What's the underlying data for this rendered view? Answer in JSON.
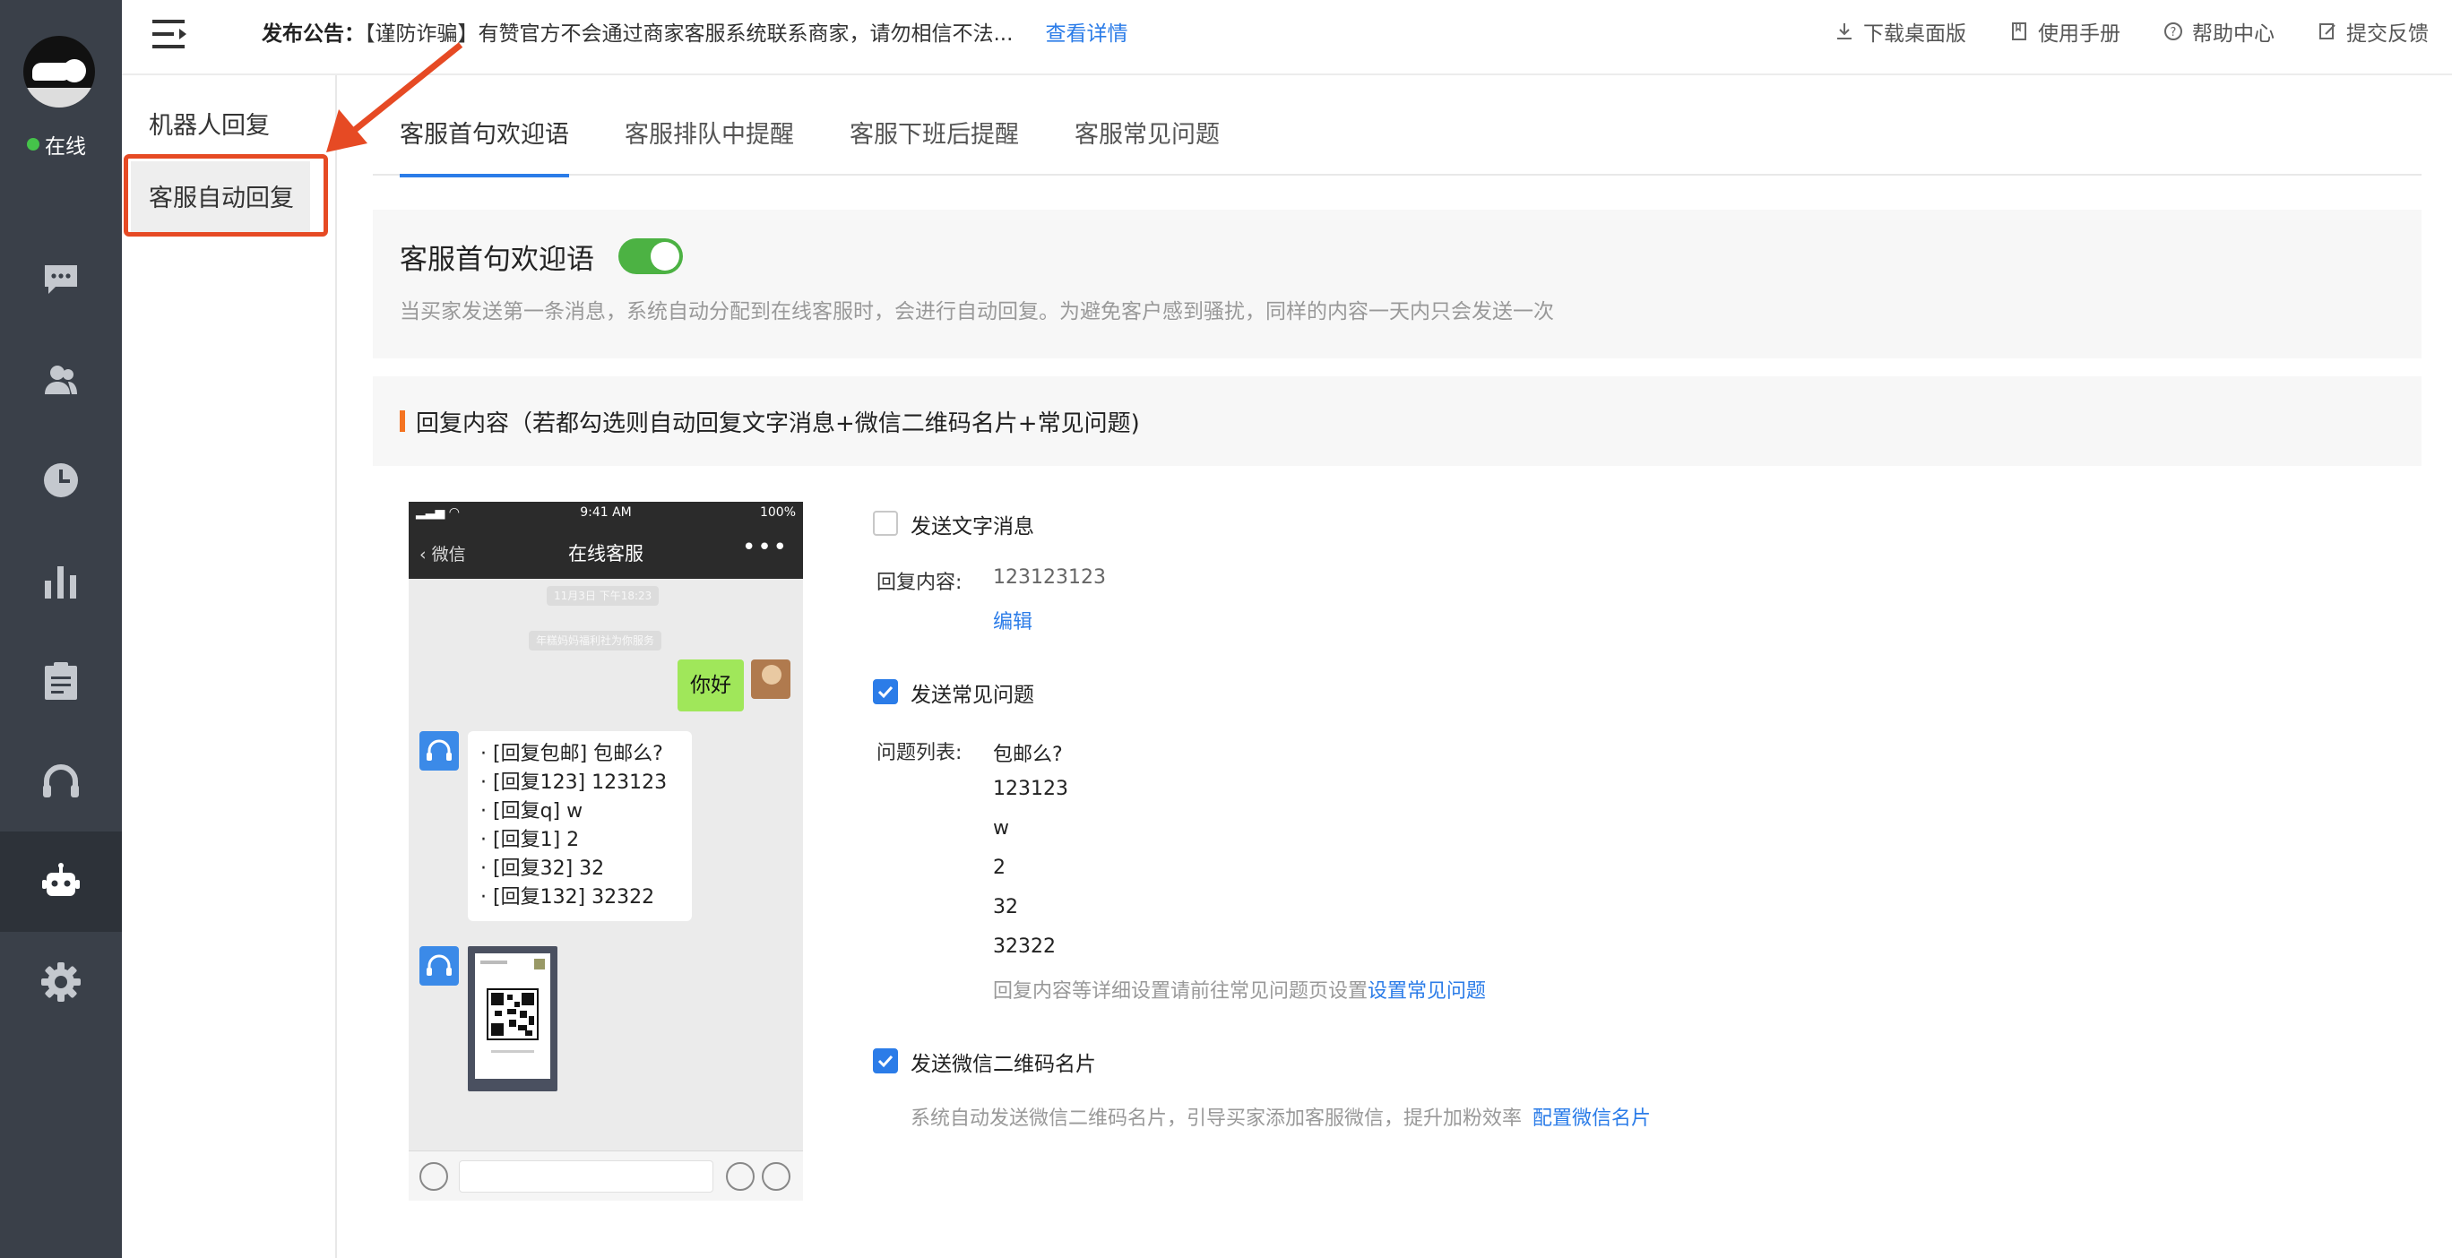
{
  "rail": {
    "status": "在线",
    "nav_icons": [
      "chat-icon",
      "contacts-icon",
      "history-icon",
      "stats-icon",
      "notes-icon",
      "headset-icon",
      "robot-icon",
      "gear-icon"
    ]
  },
  "subnav": {
    "items": [
      {
        "label": "机器人回复"
      },
      {
        "label": "客服自动回复"
      }
    ]
  },
  "topbar": {
    "notice_label": "发布公告：",
    "notice_text": "【谨防诈骗】有赞官方不会通过商家客服系统联系商家，请勿相信不法...",
    "notice_more": "查看详情",
    "links": [
      {
        "label": "下载桌面版",
        "icon": "download-icon"
      },
      {
        "label": "使用手册",
        "icon": "book-icon"
      },
      {
        "label": "帮助中心",
        "icon": "help-icon"
      },
      {
        "label": "提交反馈",
        "icon": "edit-icon"
      }
    ]
  },
  "tabs": [
    {
      "label": "客服首句欢迎语"
    },
    {
      "label": "客服排队中提醒"
    },
    {
      "label": "客服下班后提醒"
    },
    {
      "label": "客服常见问题"
    }
  ],
  "welcome": {
    "title": "客服首句欢迎语",
    "toggle_on": true,
    "description": "当买家发送第一条消息，系统自动分配到在线客服时，会进行自动回复。为避免客户感到骚扰，同样的内容一天内只会发送一次"
  },
  "section": {
    "title": "回复内容（若都勾选则自动回复文字消息+微信二维码名片+常见问题)"
  },
  "phone": {
    "time": "9:41 AM",
    "battery": "100%",
    "back": "微信",
    "title": "在线客服",
    "more": "•••",
    "pill_time": "11月3日 下午18:23",
    "pill_service": "年糕妈妈福利社为你服务",
    "my_message": "你好",
    "faq_lines": [
      "· [回复包邮] 包邮么?",
      "· [回复123] 123123",
      "· [回复q] w",
      "· [回复1] 2",
      "· [回复32] 32",
      "· [回复132] 32322"
    ]
  },
  "settings": {
    "text_msg": {
      "label": "发送文字消息",
      "checked": false,
      "content_label": "回复内容:",
      "content_value": "123123123",
      "edit": "编辑"
    },
    "faq": {
      "label": "发送常见问题",
      "checked": true,
      "list_label": "问题列表:",
      "items": [
        "包邮么?",
        "123123",
        "w",
        "2",
        "32",
        "32322"
      ],
      "hint": "回复内容等详细设置请前往常见问题页设置",
      "hint_link": "设置常见问题"
    },
    "qr": {
      "label": "发送微信二维码名片",
      "checked": true,
      "hint": "系统自动发送微信二维码名片，引导买家添加客服微信，提升加粉效率",
      "hint_link": "配置微信名片"
    }
  },
  "colors": {
    "accent": "#2b7ce8",
    "toggle": "#4cb243",
    "annotation": "#e64a24",
    "rail": "#3a4049"
  }
}
